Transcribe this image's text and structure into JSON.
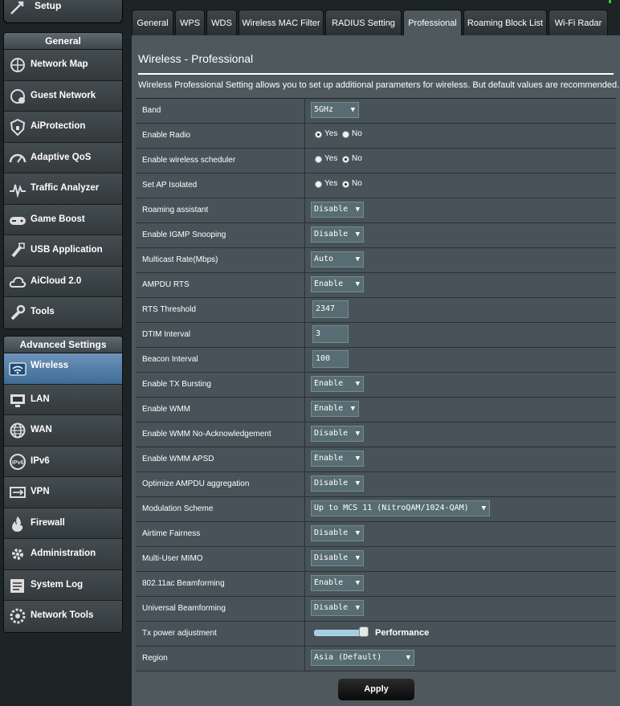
{
  "sidebar": {
    "quick_setup_label": "Setup",
    "general_heading": "General",
    "general_items": [
      {
        "label": "Network Map",
        "icon": "network-map-icon"
      },
      {
        "label": "Guest Network",
        "icon": "guest-network-icon"
      },
      {
        "label": "AiProtection",
        "icon": "aiprotection-icon"
      },
      {
        "label": "Adaptive QoS",
        "icon": "qos-gauge-icon"
      },
      {
        "label": "Traffic Analyzer",
        "icon": "traffic-analyzer-icon"
      },
      {
        "label": "Game Boost",
        "icon": "gamepad-icon"
      },
      {
        "label": "USB Application",
        "icon": "usb-icon"
      },
      {
        "label": "AiCloud 2.0",
        "icon": "cloud-icon"
      },
      {
        "label": "Tools",
        "icon": "wrench-icon"
      }
    ],
    "advanced_heading": "Advanced Settings",
    "advanced_items": [
      {
        "label": "Wireless",
        "icon": "wifi-icon",
        "active": true
      },
      {
        "label": "LAN",
        "icon": "lan-icon"
      },
      {
        "label": "WAN",
        "icon": "globe-icon"
      },
      {
        "label": "IPv6",
        "icon": "ipv6-icon"
      },
      {
        "label": "VPN",
        "icon": "vpn-icon"
      },
      {
        "label": "Firewall",
        "icon": "firewall-icon"
      },
      {
        "label": "Administration",
        "icon": "admin-gear-icon"
      },
      {
        "label": "System Log",
        "icon": "system-log-icon"
      },
      {
        "label": "Network Tools",
        "icon": "network-tools-icon"
      }
    ]
  },
  "tabs": [
    {
      "label": "General"
    },
    {
      "label": "WPS"
    },
    {
      "label": "WDS"
    },
    {
      "label": "Wireless MAC Filter"
    },
    {
      "label": "RADIUS Setting"
    },
    {
      "label": "Professional",
      "active": true
    },
    {
      "label": "Roaming Block List"
    },
    {
      "label": "Wi-Fi Radar"
    }
  ],
  "panel": {
    "title": "Wireless - Professional",
    "description": "Wireless Professional Setting allows you to set up additional parameters for wireless. But default values are recommended."
  },
  "settings": [
    {
      "label": "Band",
      "type": "select",
      "value": "5GHz"
    },
    {
      "label": "Enable Radio",
      "type": "radio",
      "yes_label": "Yes",
      "no_label": "No",
      "value": "Yes"
    },
    {
      "label": "Enable wireless scheduler",
      "type": "radio",
      "yes_label": "Yes",
      "no_label": "No",
      "value": "No"
    },
    {
      "label": "Set AP Isolated",
      "type": "radio",
      "yes_label": "Yes",
      "no_label": "No",
      "value": "No"
    },
    {
      "label": "Roaming assistant",
      "type": "select",
      "value": "Disable"
    },
    {
      "label": "Enable IGMP Snooping",
      "type": "select",
      "value": "Disable"
    },
    {
      "label": "Multicast Rate(Mbps)",
      "type": "select",
      "value": "Auto"
    },
    {
      "label": "AMPDU RTS",
      "type": "select",
      "value": "Enable"
    },
    {
      "label": "RTS Threshold",
      "type": "text",
      "value": "2347"
    },
    {
      "label": "DTIM Interval",
      "type": "text",
      "value": "3"
    },
    {
      "label": "Beacon Interval",
      "type": "text",
      "value": "100"
    },
    {
      "label": "Enable TX Bursting",
      "type": "select",
      "value": "Enable"
    },
    {
      "label": "Enable WMM",
      "type": "select",
      "value": "Enable"
    },
    {
      "label": "Enable WMM No-Acknowledgement",
      "type": "select",
      "value": "Disable"
    },
    {
      "label": "Enable WMM APSD",
      "type": "select",
      "value": "Enable"
    },
    {
      "label": "Optimize AMPDU aggregation",
      "type": "select",
      "value": "Disable"
    },
    {
      "label": "Modulation Scheme",
      "type": "select",
      "value": "Up to MCS 11 (NitroQAM/1024-QAM)"
    },
    {
      "label": "Airtime Fairness",
      "type": "select",
      "value": "Disable"
    },
    {
      "label": "Multi-User MIMO",
      "type": "select",
      "value": "Disable"
    },
    {
      "label": "802.11ac Beamforming",
      "type": "select",
      "value": "Enable"
    },
    {
      "label": "Universal Beamforming",
      "type": "select",
      "value": "Disable"
    },
    {
      "label": "Tx power adjustment",
      "type": "slider",
      "value_text": "Performance",
      "level": 1.0
    },
    {
      "label": "Region",
      "type": "select",
      "value": "Asia (Default)"
    }
  ],
  "apply_label": "Apply",
  "colors": {
    "panel_bg": "#4d595d",
    "active_menu": "#5a85b0",
    "page_bg": "#1d2426"
  }
}
